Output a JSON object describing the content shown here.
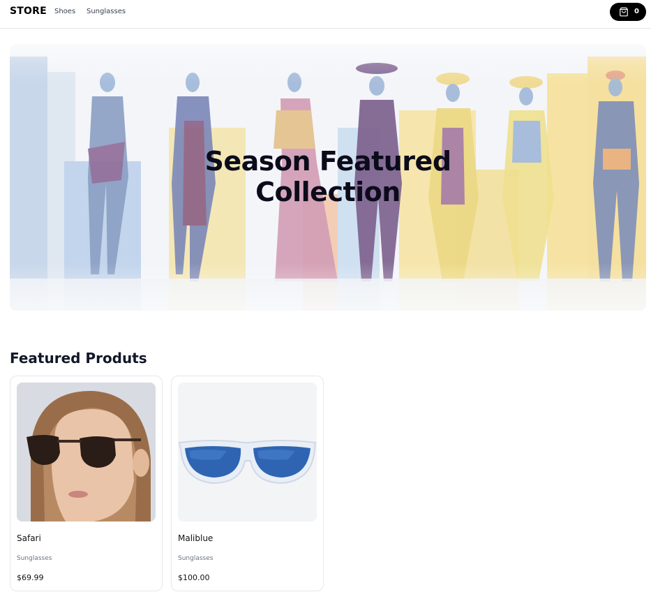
{
  "header": {
    "logo": "STORE",
    "nav": [
      {
        "label": "Shoes"
      },
      {
        "label": "Sunglasses"
      }
    ],
    "cart": {
      "icon": "shopping-bag-icon",
      "count": "0"
    }
  },
  "hero": {
    "title_line1": "Season Featured",
    "title_line2": "Collection"
  },
  "featured": {
    "title": "Featured Produts",
    "products": [
      {
        "name": "Safari",
        "category": "Sunglasses",
        "price": "$69.99"
      },
      {
        "name": "Maliblue",
        "category": "Sunglasses",
        "price": "$100.00"
      }
    ]
  },
  "colors": {
    "accent": "#000000",
    "border": "#e5e7eb",
    "muted_text": "#6b7280"
  }
}
